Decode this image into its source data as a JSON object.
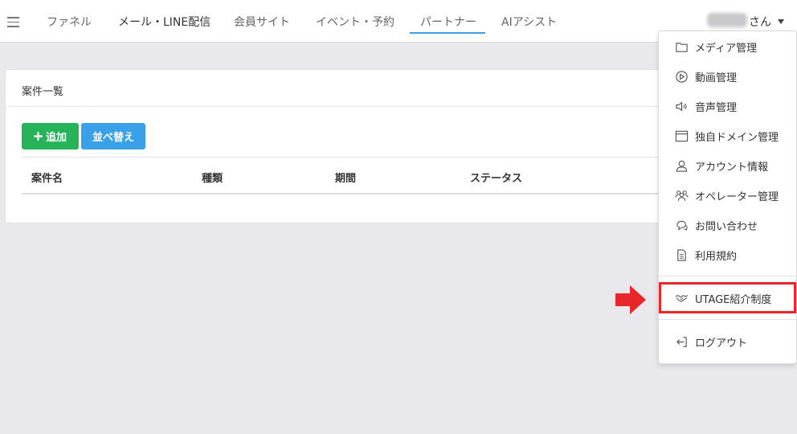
{
  "nav": {
    "items": [
      {
        "label": "ファネル"
      },
      {
        "label": "メール・LINE配信"
      },
      {
        "label": "会員サイト"
      },
      {
        "label": "イベント・予約"
      },
      {
        "label": "パートナー"
      },
      {
        "label": "AIアシスト"
      }
    ],
    "active": "パートナー",
    "user_suffix": "さん"
  },
  "card": {
    "title": "案件一覧",
    "add_label": "追加",
    "sort_label": "並べ替え",
    "columns": [
      "案件名",
      "種類",
      "期間",
      "ステータス"
    ]
  },
  "dropdown": {
    "items": [
      {
        "label": "メディア管理",
        "icon": "folder-icon"
      },
      {
        "label": "動画管理",
        "icon": "play-circle-icon"
      },
      {
        "label": "音声管理",
        "icon": "speaker-icon"
      },
      {
        "label": "独自ドメイン管理",
        "icon": "browser-window-icon"
      },
      {
        "label": "アカウント情報",
        "icon": "person-icon"
      },
      {
        "label": "オペレーター管理",
        "icon": "people-icon"
      },
      {
        "label": "お問い合わせ",
        "icon": "chat-icon"
      },
      {
        "label": "利用規約",
        "icon": "document-icon"
      }
    ],
    "referral": {
      "label": "UTAGE紹介制度",
      "icon": "handshake-icon"
    },
    "logout": {
      "label": "ログアウト",
      "icon": "logout-icon"
    }
  },
  "colors": {
    "accent": "#3aa0e8",
    "add_button": "#27b35a",
    "highlight": "#e8272d",
    "background": "#e9e9eb"
  }
}
